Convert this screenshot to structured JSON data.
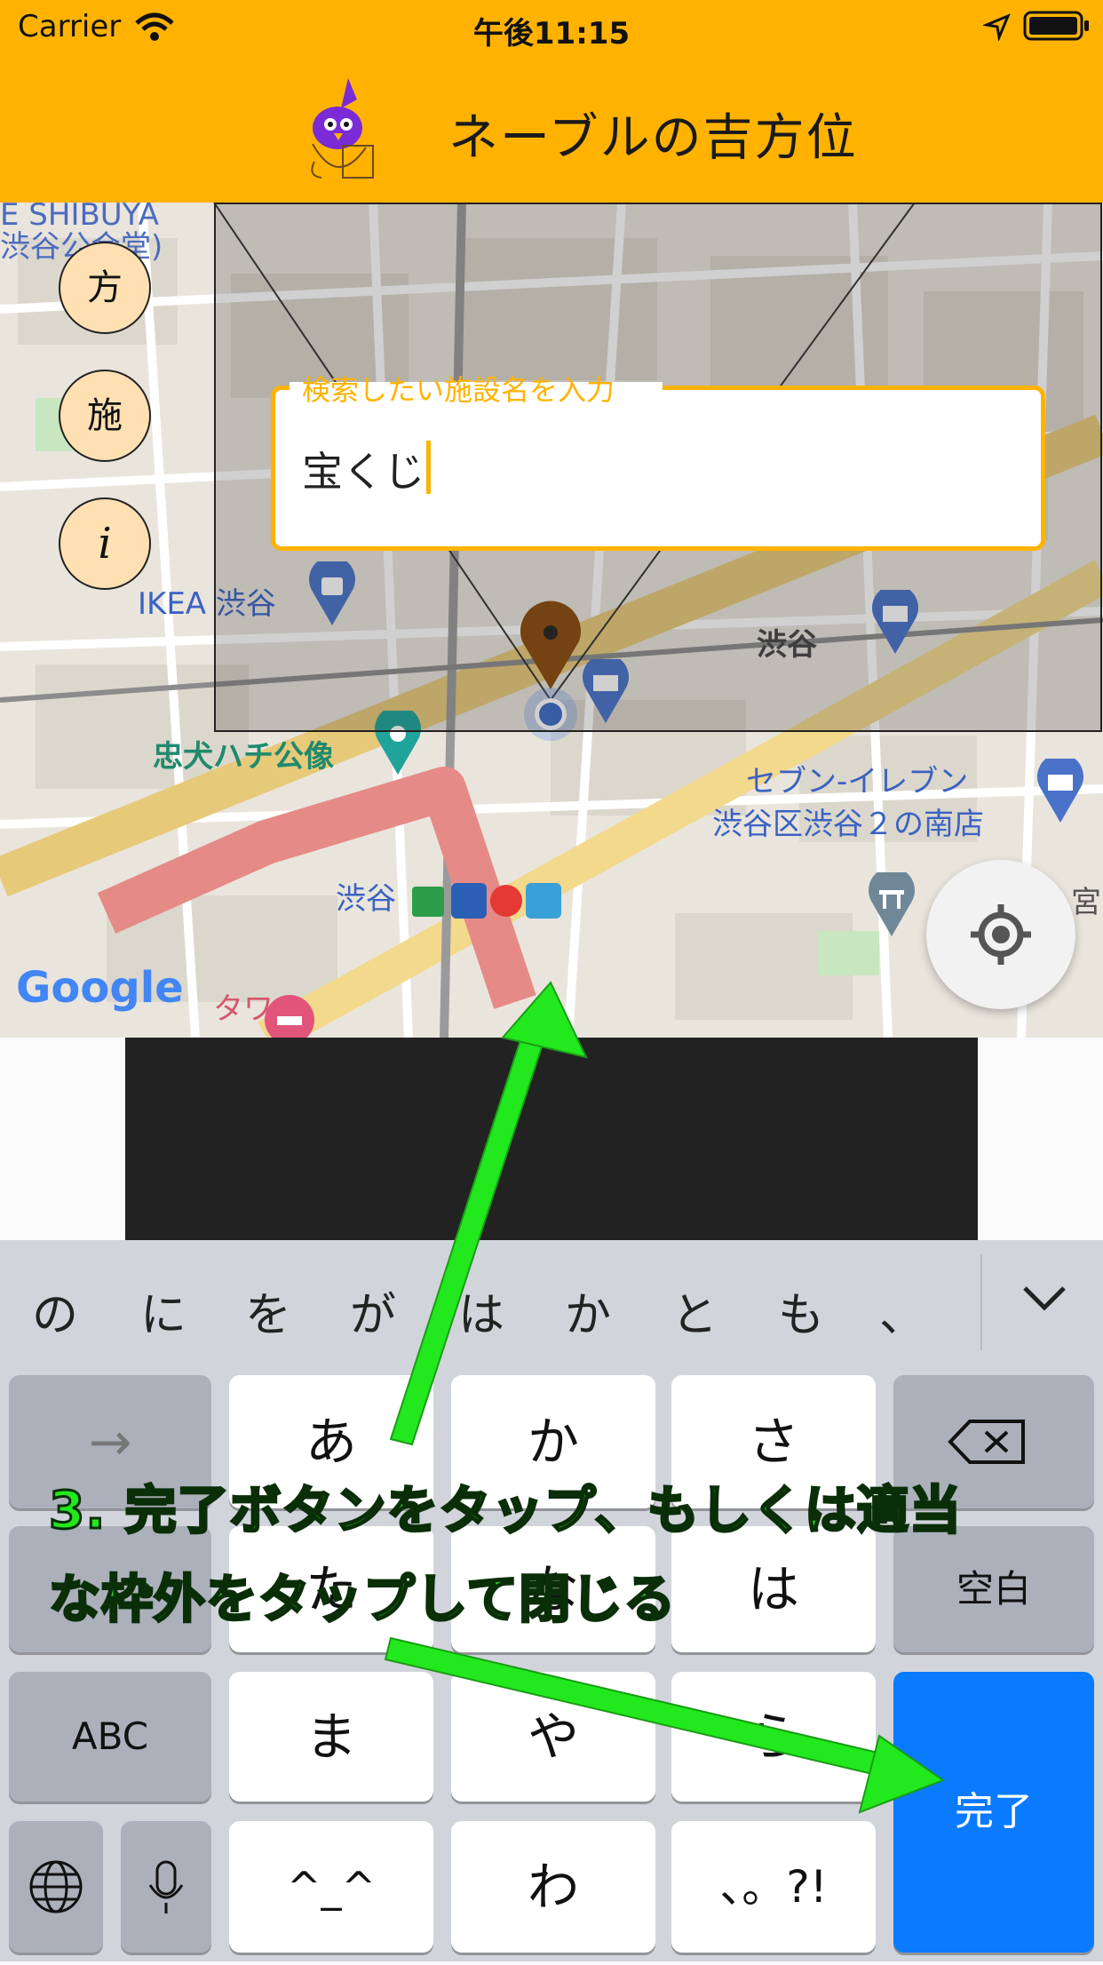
{
  "status_bar": {
    "carrier": "Carrier",
    "time": "午後11:15"
  },
  "header": {
    "title": "ネーブルの吉方位"
  },
  "side_buttons": [
    {
      "label": "方"
    },
    {
      "label": "施"
    },
    {
      "label": "i"
    }
  ],
  "search": {
    "label": "検索したい施設名を入力",
    "value": "宝くじ"
  },
  "map": {
    "labels": {
      "ikea": "IKEA 渋谷",
      "shibuya_area": "渋谷",
      "hachiko": "忠犬ハチ公像",
      "seven_1": "セブン-イレブン",
      "seven_2": "渋谷区渋谷２の南店",
      "station": "渋谷",
      "google": "Google",
      "top_left_1": "E SHIBUYA",
      "top_left_2": "渋谷公会堂)",
      "tower": "タワー",
      "miya": "宮"
    }
  },
  "keyboard": {
    "candidates": [
      "の",
      "に",
      "を",
      "が",
      "は",
      "か",
      "と",
      "も",
      "、"
    ],
    "row1": [
      "→",
      "あ",
      "か",
      "さ"
    ],
    "row2": [
      "",
      "た",
      "な",
      "は",
      "空白"
    ],
    "row3": [
      "ABC",
      "ま",
      "や",
      "ら"
    ],
    "row4": [
      "",
      "",
      "^_^",
      "わ",
      "、。?!"
    ],
    "done": "完了"
  },
  "annotation": {
    "line1": "3. 完了ボタンをタップ、もしくは適当",
    "line2": "な枠外をタップして閉じる"
  }
}
